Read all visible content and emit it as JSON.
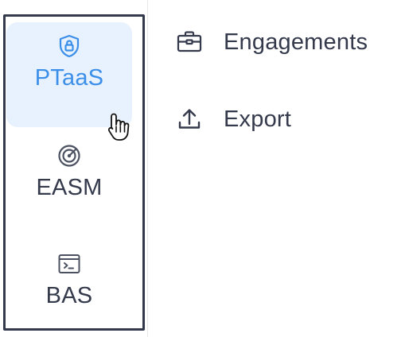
{
  "sidebar": {
    "items": [
      {
        "label": "PTaaS",
        "icon": "shield-lock-icon",
        "active": true
      },
      {
        "label": "EASM",
        "icon": "radar-icon",
        "active": false
      },
      {
        "label": "BAS",
        "icon": "terminal-icon",
        "active": false
      }
    ]
  },
  "submenu": {
    "items": [
      {
        "label": "Engagements",
        "icon": "briefcase-icon"
      },
      {
        "label": "Export",
        "icon": "upload-icon"
      }
    ]
  },
  "colors": {
    "accent": "#3b8fe8",
    "active_background": "#e8f1fe",
    "text": "#343a4c",
    "outline": "#343a4c"
  }
}
